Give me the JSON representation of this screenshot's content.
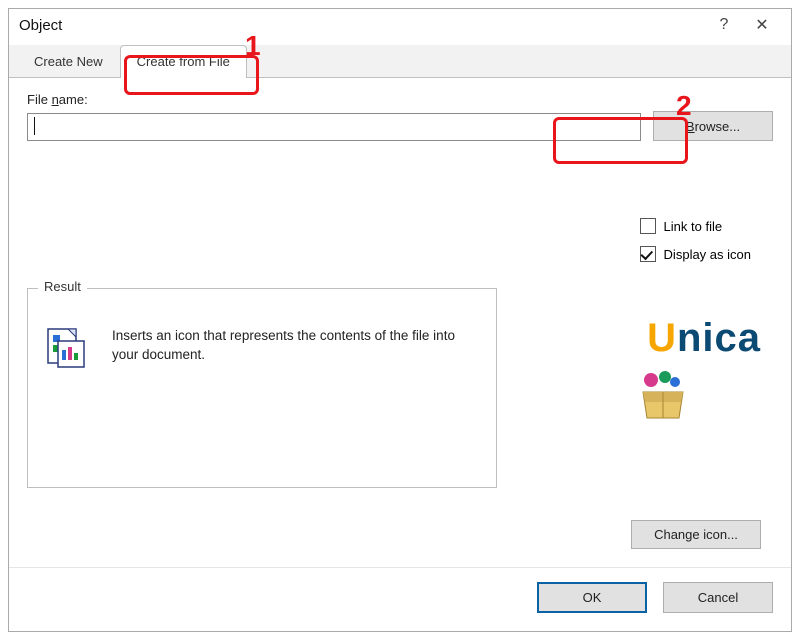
{
  "titlebar": {
    "title": "Object"
  },
  "tabs": {
    "create_new": "Create New",
    "create_from_file": "Create from File"
  },
  "file": {
    "label_pre": "File ",
    "label_u": "n",
    "label_post": "ame:",
    "value": "",
    "browse_u": "B",
    "browse_rest": "rowse..."
  },
  "checks": {
    "link_u": "L",
    "link_rest": "ink to file",
    "display_pre": "Disp",
    "display_u": "l",
    "display_post": "ay as icon"
  },
  "result": {
    "legend": "Result",
    "text": "Inserts an icon that represents the contents of the file into your document."
  },
  "change_icon": "Change icon...",
  "footer": {
    "ok": "OK",
    "cancel": "Cancel"
  },
  "annotations": {
    "num1": "1",
    "num2": "2"
  },
  "watermark": {
    "u": "U",
    "rest": "nica"
  }
}
